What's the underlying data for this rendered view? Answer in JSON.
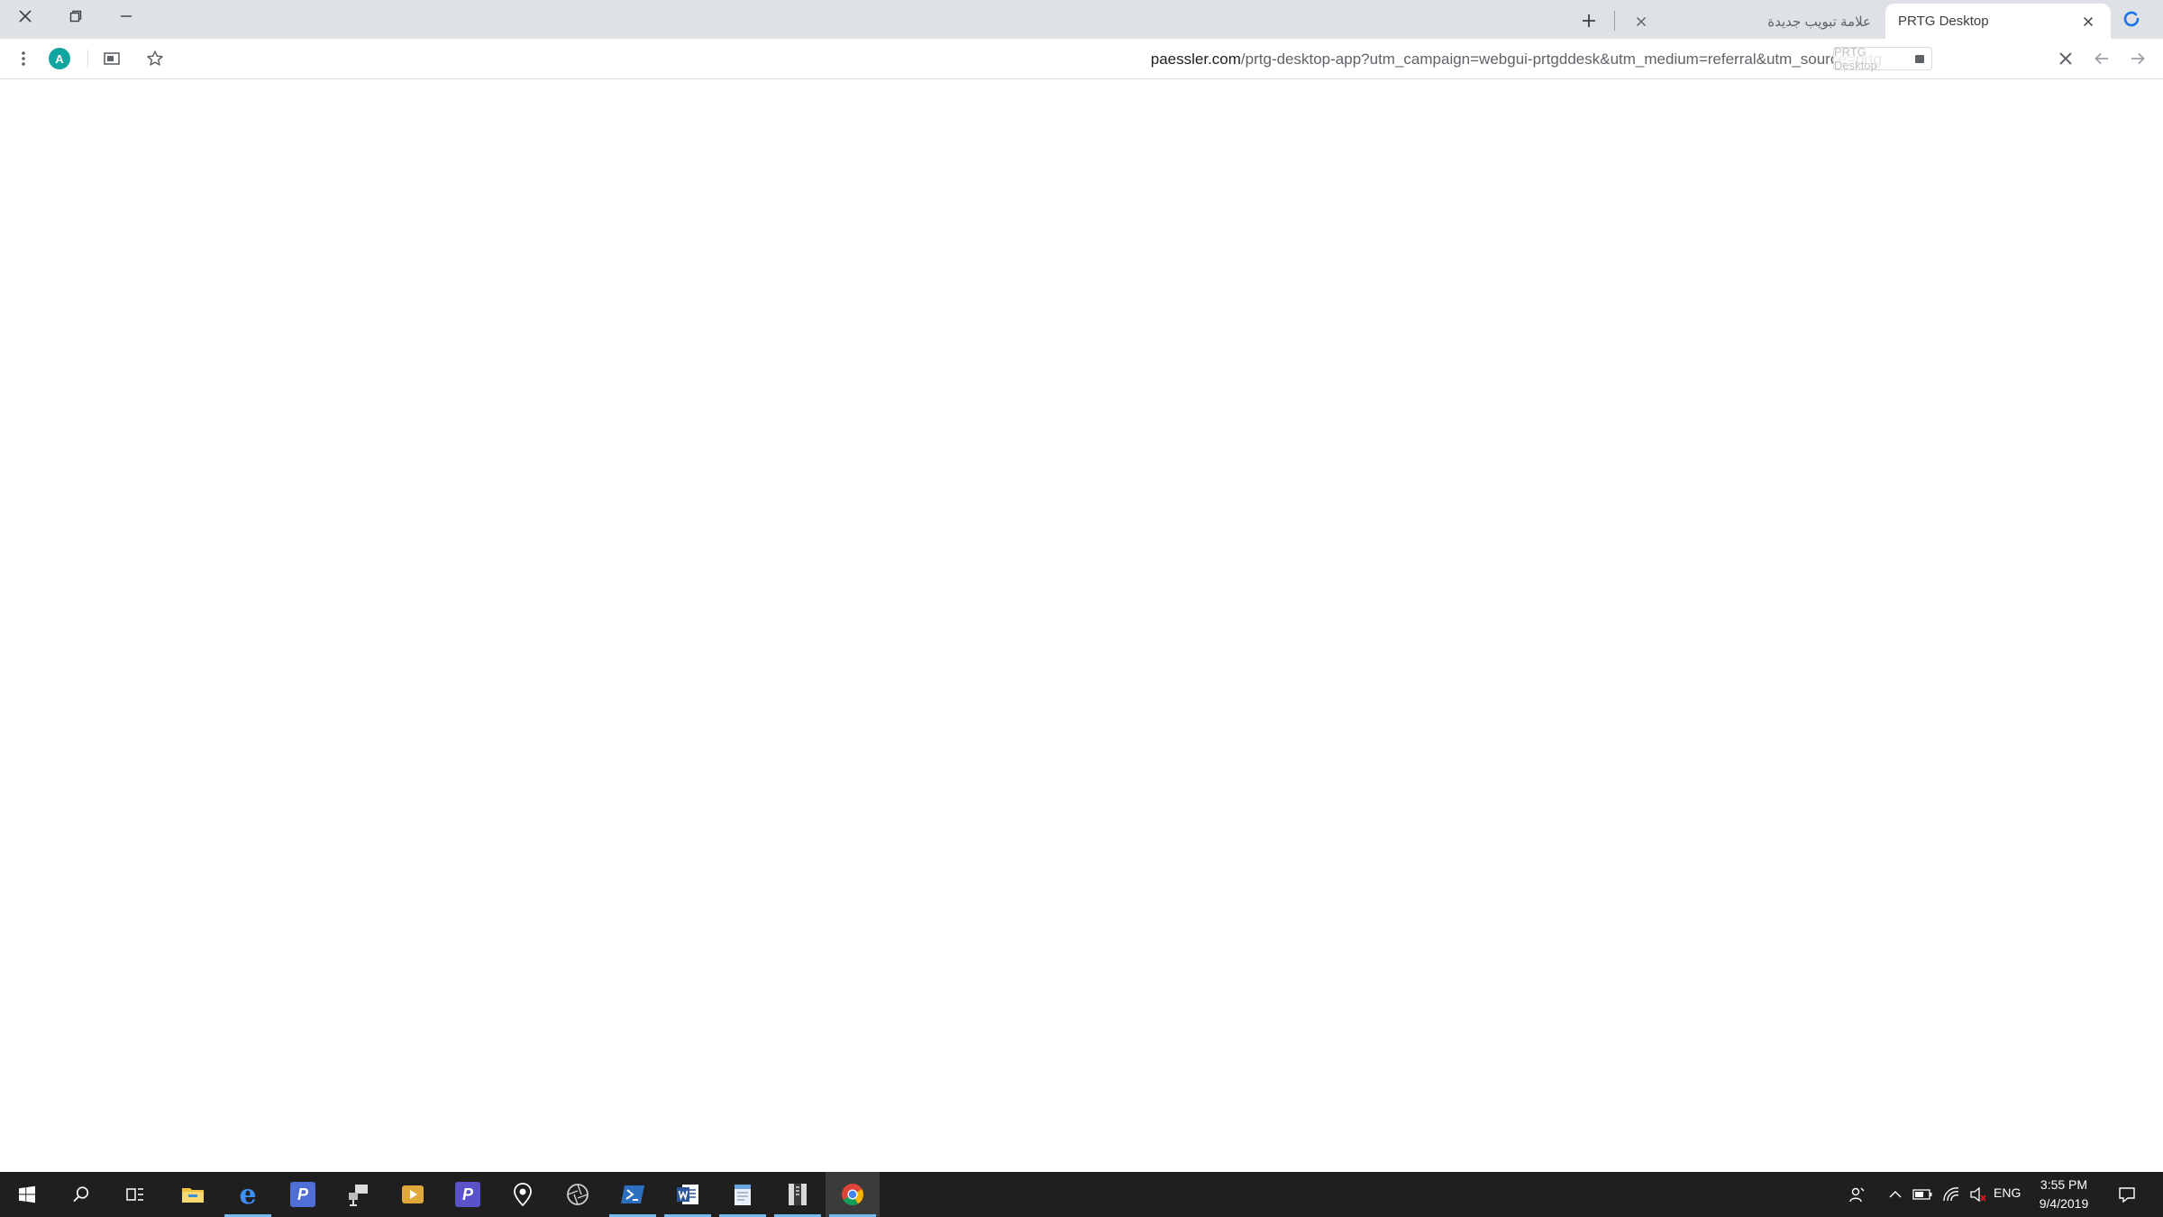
{
  "browser": {
    "tabs": [
      {
        "title": "PRTG Desktop",
        "active": true
      },
      {
        "title": "علامة تبويب جديدة",
        "active": false
      }
    ],
    "address": {
      "host": "paessler.com",
      "path": "/prtg-desktop-app?utm_campaign=webgui-prtgddesk&utm_medium=referral&utm_source=prtg"
    },
    "password_chip": "PRTG Desktop",
    "avatar_letter": "A"
  },
  "taskbar": {
    "time": "3:55 PM",
    "date": "9/4/2019",
    "language": "ENG",
    "pinned": [
      {
        "name": "file-explorer",
        "icon": "folder-icon",
        "running": false
      },
      {
        "name": "edge",
        "icon": "edge-icon",
        "running": true
      },
      {
        "name": "app-p-blue",
        "icon": "p-app-icon",
        "running": false
      },
      {
        "name": "network-tool",
        "icon": "network-icon",
        "running": false
      },
      {
        "name": "media-player",
        "icon": "play-icon",
        "running": false
      },
      {
        "name": "app-p-purple",
        "icon": "p-app-icon",
        "running": false
      },
      {
        "name": "maps",
        "icon": "map-pin-icon",
        "running": false
      },
      {
        "name": "camera-app",
        "icon": "aperture-icon",
        "running": false
      },
      {
        "name": "powershell",
        "icon": "terminal-icon",
        "running": true
      },
      {
        "name": "word",
        "icon": "word-icon",
        "running": true
      },
      {
        "name": "notepad",
        "icon": "notepad-icon",
        "running": true
      },
      {
        "name": "archive-tool",
        "icon": "archive-icon",
        "running": true
      },
      {
        "name": "chrome",
        "icon": "chrome-icon",
        "running": true
      }
    ]
  },
  "colors": {
    "tabstrip": "#dee1e6",
    "taskbar": "#1f1f1f",
    "accent": "#1a73e8",
    "avatar": "#12a4a0"
  }
}
